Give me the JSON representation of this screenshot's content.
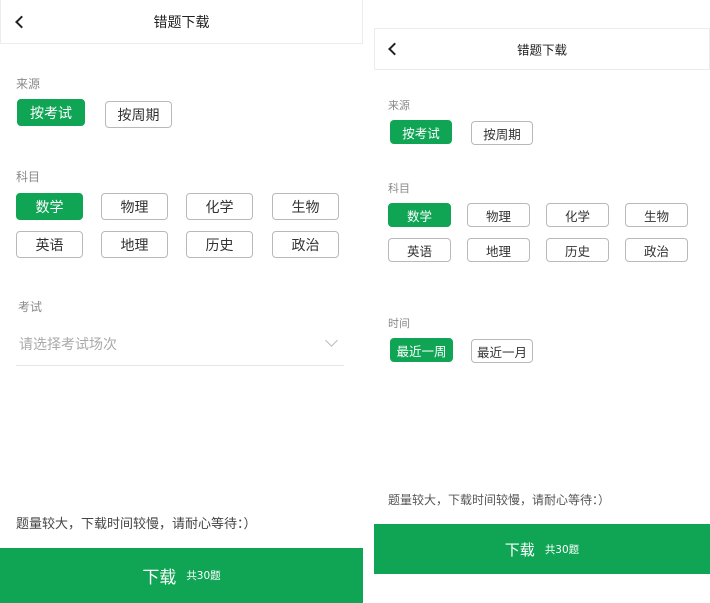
{
  "header": {
    "title": "错题下载"
  },
  "source": {
    "label": "来源",
    "options": [
      "按考试",
      "按周期"
    ]
  },
  "subject": {
    "label": "科目",
    "options": [
      "数学",
      "物理",
      "化学",
      "生物",
      "英语",
      "地理",
      "历史",
      "政治"
    ]
  },
  "exam": {
    "label": "考试",
    "placeholder": "请选择考试场次"
  },
  "time": {
    "label": "时间",
    "options": [
      "最近一周",
      "最近一月"
    ]
  },
  "notice": "题量较大，下载时间较慢，请耐心等待：）",
  "download": {
    "label": "下载",
    "count": "共30题"
  },
  "colors": {
    "accent": "#0fa554"
  }
}
